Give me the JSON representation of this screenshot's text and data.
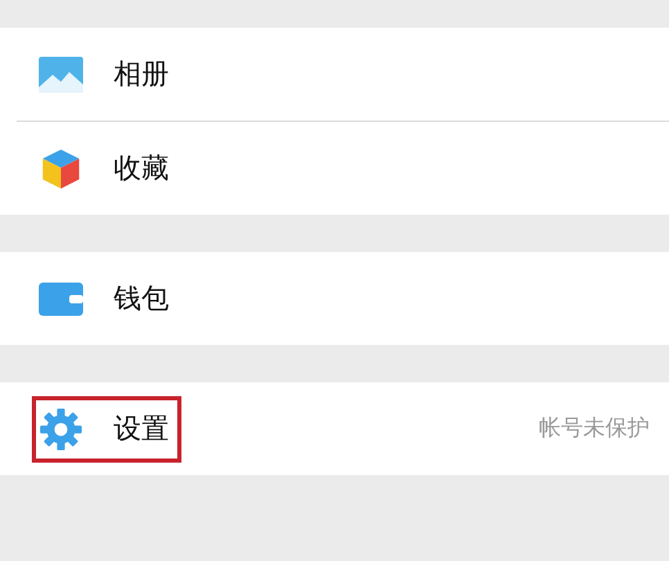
{
  "sections": [
    {
      "items": [
        {
          "label": "相册",
          "highlighted": false
        },
        {
          "label": "收藏",
          "highlighted": false
        }
      ]
    },
    {
      "items": [
        {
          "label": "钱包",
          "highlighted": false
        }
      ]
    },
    {
      "items": [
        {
          "label": "设置",
          "highlighted": true,
          "detail": "帐号未保护"
        }
      ]
    }
  ]
}
